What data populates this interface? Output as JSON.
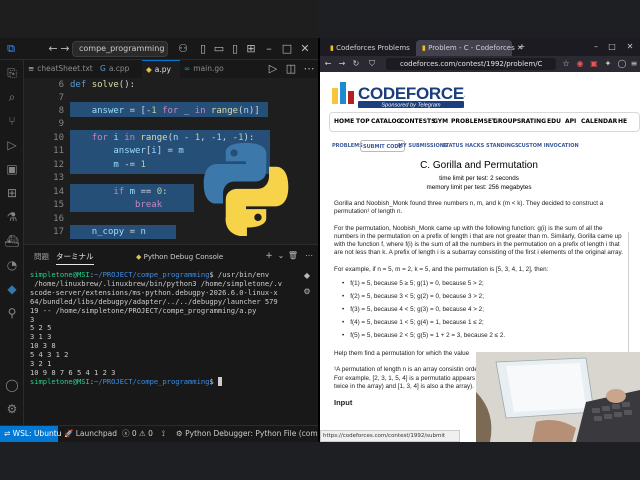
{
  "vscode": {
    "command_center": "compe_programming [WS...",
    "tabs": [
      {
        "label": "cheatSheet.txt"
      },
      {
        "label": "a.cpp"
      },
      {
        "label": "a.py"
      },
      {
        "label": "main.go"
      }
    ],
    "editor": {
      "lines": [
        {
          "num": "6",
          "text": "def solve():"
        },
        {
          "num": "7",
          "text": ""
        },
        {
          "num": "8",
          "text": "    answer = [-1 for _ in range(n)]"
        },
        {
          "num": "9",
          "text": ""
        },
        {
          "num": "10",
          "text": "    for i in range(n - 1, -1, -1):"
        },
        {
          "num": "11",
          "text": "        answer[i] = m"
        },
        {
          "num": "12",
          "text": "        m -= 1"
        },
        {
          "num": "13",
          "text": ""
        },
        {
          "num": "14",
          "text": "        if m == 0:"
        },
        {
          "num": "15",
          "text": "            break"
        },
        {
          "num": "16",
          "text": ""
        },
        {
          "num": "17",
          "text": "    n_copy = n"
        }
      ]
    },
    "panel": {
      "tab_problems": "問題",
      "tab_terminal": "ターミナル",
      "terminal_selector": "Python Debug Console",
      "terminal_lines": [
        "simpletone@MSI:~/PROJECT/compe_programming$ /usr/bin/env",
        " /home/linuxbrew/.linuxbrew/bin/python3 /home/simpletone/.v",
        "scode-server/extensions/ms-python.debugpy-2026.6.0-linux-x",
        "64/bundled/libs/debugpy/adapter/../../debugpy/launcher 579",
        "19 -- /home/simpletone/PROJECT/compe_programming/a.py",
        "3",
        "5 2 5",
        "3 1 3",
        "10 3 8",
        "5 4 3 1 2",
        "3 2 1",
        "10 9 8 7 6 5 4 1 2 3",
        "simpletone@MSI:~/PROJECT/compe_programming$ "
      ]
    },
    "status": {
      "remote": "WSL: Ubuntu",
      "launchpad": "Launchpad",
      "errors": "0",
      "warnings": "0",
      "debugger": "Python Debugger: Python File (compe"
    }
  },
  "browser": {
    "tabs": [
      {
        "label": "Codeforces Problems"
      },
      {
        "label": "Problem - C - Codeforces"
      }
    ],
    "url": "codeforces.com/contest/1992/problem/C",
    "menu": [
      "HOME",
      "TOP",
      "CATALOG",
      "CONTESTS",
      "GYM",
      "PROBLEMSET",
      "GROUPS",
      "RATING",
      "EDU",
      "API",
      "CALENDAR",
      "HE"
    ],
    "subnav": [
      "PROBLEMS",
      "SUBMIT CODE",
      "MY SUBMISSIONS",
      "STATUS",
      "HACKS",
      "STANDINGS",
      "CUSTOM INVOCATION"
    ],
    "logo_text": "CODEFORCES",
    "logo_sub": "Sponsored by Telegram",
    "problem": {
      "title": "C. Gorilla and Permutation",
      "time_limit": "time limit per test: 2 seconds",
      "memory_limit": "memory limit per test: 256 megabytes",
      "p1": "Gorilla and Noobish_Monk found three numbers n, m, and k (m < k). They decided to construct a permutation¹ of length n.",
      "p2": "For the permutation, Noobish_Monk came up with the following function: g(i) is the sum of all the numbers in the permutation on a prefix of length i that are not greater than m. Similarly, Gorilla came up with the function f, where f(i) is the sum of all the numbers in the permutation on a prefix of length i that are not less than k. A prefix of length i is a subarray consisting of the first i elements of the original array.",
      "p3": "For example, if n = 5, m = 2, k = 5, and the permutation is [5, 3, 4, 1, 2], then:",
      "list": [
        "f(1) = 5, because 5 ≥ 5; g(1) = 0, because 5 > 2;",
        "f(2) = 5, because 3 < 5; g(2) = 0, because 3 > 2;",
        "f(3) = 5, because 4 < 5; g(3) = 0, because 4 > 2;",
        "f(4) = 5, because 1 < 5; g(4) = 1, because 1 ≤ 2;",
        "f(5) = 5, because 2 < 5; g(5) = 1 + 2 = 3, because 2 ≤ 2."
      ],
      "p4": "Help them find a permutation for which the value",
      "p5": "¹A permutation of length n is an array consistin order. For example, [2, 3, 1, 5, 4] is a permutatio appears twice in the array) and [1, 3, 4] is also a the array).",
      "input_heading": "Input"
    },
    "status_url": "https://codeforces.com/contest/1992/submit"
  },
  "colors": {
    "accent": "#0078d4",
    "cf_link": "#3b5998"
  }
}
